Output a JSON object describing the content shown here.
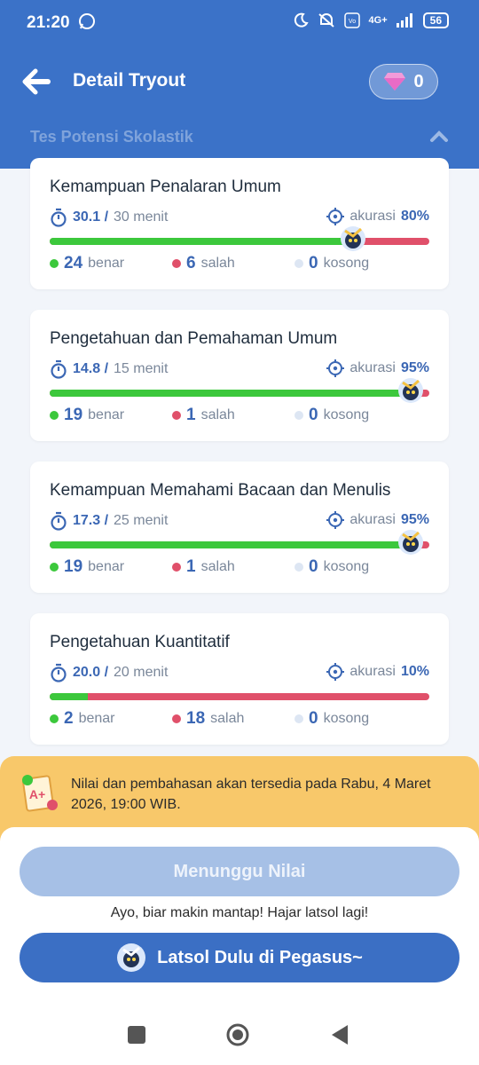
{
  "status_bar": {
    "time": "21:20",
    "battery": "56",
    "network": "4G+"
  },
  "header": {
    "title": "Detail Tryout",
    "gem_count": "0"
  },
  "section": {
    "title": "Tes Potensi Skolastik"
  },
  "cards": [
    {
      "name": "Kemampuan Penalaran Umum",
      "time_used": "30.1 /",
      "time_total": "30 menit",
      "accuracy_label": "akurasi",
      "accuracy": "80%",
      "accuracy_value": 0.8,
      "benar": "24",
      "benar_label": "benar",
      "salah": "6",
      "salah_label": "salah",
      "kosong": "0",
      "kosong_label": "kosong"
    },
    {
      "name": "Pengetahuan dan Pemahaman Umum",
      "time_used": "14.8 /",
      "time_total": "15 menit",
      "accuracy_label": "akurasi",
      "accuracy": "95%",
      "accuracy_value": 0.95,
      "benar": "19",
      "benar_label": "benar",
      "salah": "1",
      "salah_label": "salah",
      "kosong": "0",
      "kosong_label": "kosong"
    },
    {
      "name": "Kemampuan Memahami Bacaan dan Menulis",
      "time_used": "17.3 /",
      "time_total": "25 menit",
      "accuracy_label": "akurasi",
      "accuracy": "95%",
      "accuracy_value": 0.95,
      "benar": "19",
      "benar_label": "benar",
      "salah": "1",
      "salah_label": "salah",
      "kosong": "0",
      "kosong_label": "kosong"
    },
    {
      "name": "Pengetahuan Kuantitatif",
      "time_used": "20.0 /",
      "time_total": "20 menit",
      "accuracy_label": "akurasi",
      "accuracy": "10%",
      "accuracy_value": 0.1,
      "benar": "2",
      "benar_label": "benar",
      "salah": "18",
      "salah_label": "salah",
      "kosong": "0",
      "kosong_label": "kosong"
    }
  ],
  "notice": {
    "text": "Nilai dan pembahasan akan tersedia pada Rabu, 4 Maret 2026, 19:00 WIB."
  },
  "actions": {
    "wait_label": "Menunggu Nilai",
    "hint": "Ayo, biar makin mantap! Hajar latsol lagi!",
    "go_label": "Latsol Dulu di Pegasus~"
  },
  "colors": {
    "primary": "#3b72c8",
    "correct": "#3cc83c",
    "wrong": "#e0506a",
    "empty": "#dde6f3",
    "notice": "#f8c86a"
  }
}
